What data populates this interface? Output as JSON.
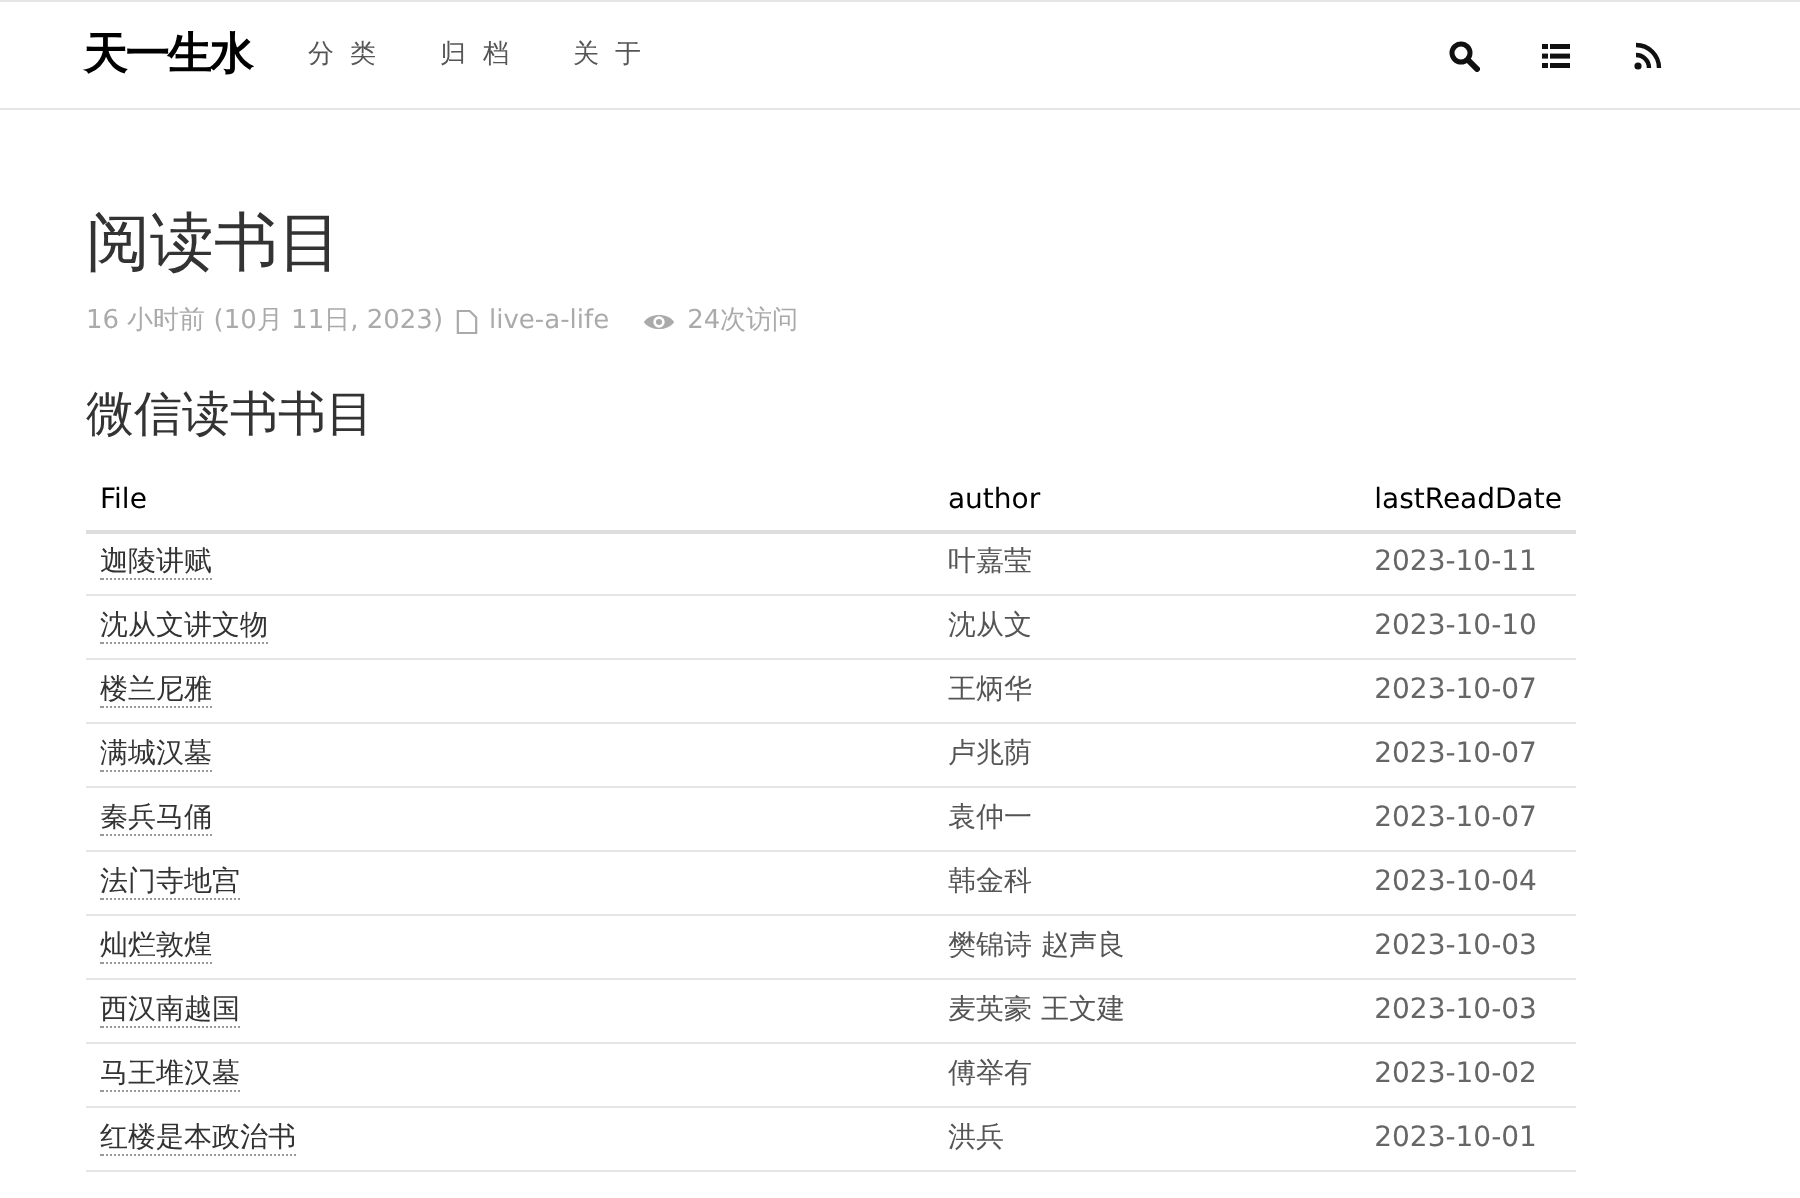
{
  "header": {
    "logo": "天一生水",
    "nav": [
      {
        "label": "分 类"
      },
      {
        "label": "归 档"
      },
      {
        "label": "关 于"
      }
    ]
  },
  "post": {
    "title": "阅读书目",
    "meta": {
      "time": "16 小时前 (10月 11日, 2023)",
      "category": "live-a-life",
      "views": "24次访问"
    }
  },
  "section_title": "微信读书书目",
  "table": {
    "columns": [
      "File",
      "author",
      "lastReadDate"
    ],
    "rows": [
      {
        "file": "迦陵讲赋",
        "author": "叶嘉莹",
        "date": "2023-10-11"
      },
      {
        "file": "沈从文讲文物",
        "author": "沈从文",
        "date": "2023-10-10"
      },
      {
        "file": "楼兰尼雅",
        "author": "王炳华",
        "date": "2023-10-07"
      },
      {
        "file": "满城汉墓",
        "author": "卢兆荫",
        "date": "2023-10-07"
      },
      {
        "file": "秦兵马俑",
        "author": "袁仲一",
        "date": "2023-10-07"
      },
      {
        "file": "法门寺地宫",
        "author": "韩金科",
        "date": "2023-10-04"
      },
      {
        "file": "灿烂敦煌",
        "author": "樊锦诗 赵声良",
        "date": "2023-10-03"
      },
      {
        "file": "西汉南越国",
        "author": "麦英豪 王文建",
        "date": "2023-10-03"
      },
      {
        "file": "马王堆汉墓",
        "author": "傅举有",
        "date": "2023-10-02"
      },
      {
        "file": "红楼是本政治书",
        "author": "洪兵",
        "date": "2023-10-01"
      }
    ]
  }
}
